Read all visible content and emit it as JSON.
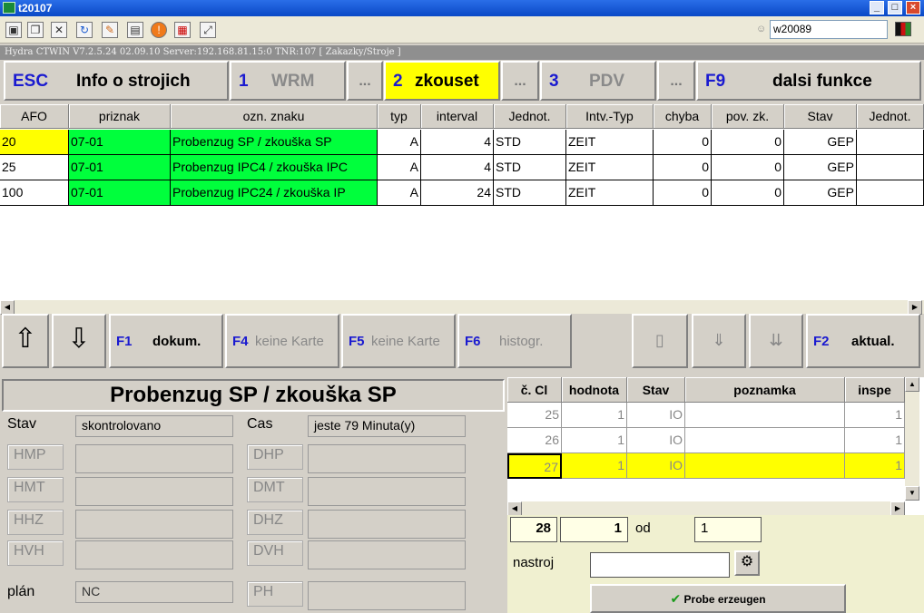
{
  "window": {
    "title": "t20107"
  },
  "toolbar": {
    "icons": [
      "monitor-icon",
      "windows-icon",
      "tools-icon",
      "refresh-icon",
      "paint-icon",
      "printer-icon",
      "alert-icon",
      "network-icon",
      "fullscreen-icon"
    ],
    "user": "w20089"
  },
  "status_line": "Hydra CTWIN V7.2.5.24  02.09.10  Server:192.168.81.15:0 TNR:107  [ Zakazky/Stroje ]",
  "function_buttons": [
    {
      "key": "ESC",
      "label": "Info o strojich"
    },
    {
      "key": "1",
      "label": "WRM"
    },
    {
      "key": "",
      "label": "..."
    },
    {
      "key": "2",
      "label": "zkouset"
    },
    {
      "key": "",
      "label": "..."
    },
    {
      "key": "3",
      "label": "PDV"
    },
    {
      "key": "",
      "label": "..."
    },
    {
      "key": "F9",
      "label": "dalsi funkce"
    }
  ],
  "main_table": {
    "columns": [
      "AFO",
      "priznak",
      "ozn. znaku",
      "typ",
      "interval",
      "Jednot.",
      "Intv.-Typ",
      "chyba",
      "pov. zk.",
      "Stav",
      "Jednot."
    ],
    "rows": [
      [
        "20",
        "07-01",
        "Probenzug SP / zkouška SP",
        "A",
        "4",
        "STD",
        "ZEIT",
        "0",
        "0",
        "GEP",
        ""
      ],
      [
        "25",
        "07-01",
        "Probenzug IPC4 / zkouška IPC",
        "A",
        "4",
        "STD",
        "ZEIT",
        "0",
        "0",
        "GEP",
        ""
      ],
      [
        "100",
        "07-01",
        "Probenzug IPC24 / zkouška IP",
        "A",
        "24",
        "STD",
        "ZEIT",
        "0",
        "0",
        "GEP",
        ""
      ]
    ]
  },
  "second_buttons": [
    {
      "key": "F1",
      "label": "dokum."
    },
    {
      "key": "F4",
      "label": "keine Karte"
    },
    {
      "key": "F5",
      "label": "keine Karte"
    },
    {
      "key": "F6",
      "label": "histogr."
    },
    {
      "key": "F2",
      "label": "aktual."
    }
  ],
  "detail": {
    "title": "Probenzug SP / zkouška SP",
    "stav_label": "Stav",
    "stav_value": "skontrolovano",
    "cas_label": "Cas",
    "cas_value": "jeste  79 Minuta(y)",
    "left_labels": [
      "HMP",
      "HMT",
      "HHZ",
      "HVH"
    ],
    "right_labels": [
      "DHP",
      "DMT",
      "DHZ",
      "DVH"
    ],
    "plan_label": "plán",
    "plan_value": "NC",
    "ph_label": "PH"
  },
  "sample_table": {
    "columns": [
      "č. Cl",
      "hodnota",
      "Stav",
      "poznamka",
      "inspe"
    ],
    "rows": [
      [
        "25",
        "1",
        "IO",
        "",
        "1"
      ],
      [
        "26",
        "1",
        "IO",
        "",
        "1"
      ],
      [
        "27",
        "1",
        "IO",
        "",
        "1"
      ]
    ]
  },
  "sample_form": {
    "count": "28",
    "value": "1",
    "od_label": "od",
    "od_value": "1",
    "nastroj_label": "nastroj",
    "nastroj_value": "",
    "probe_button": "Probe erzeugen"
  }
}
